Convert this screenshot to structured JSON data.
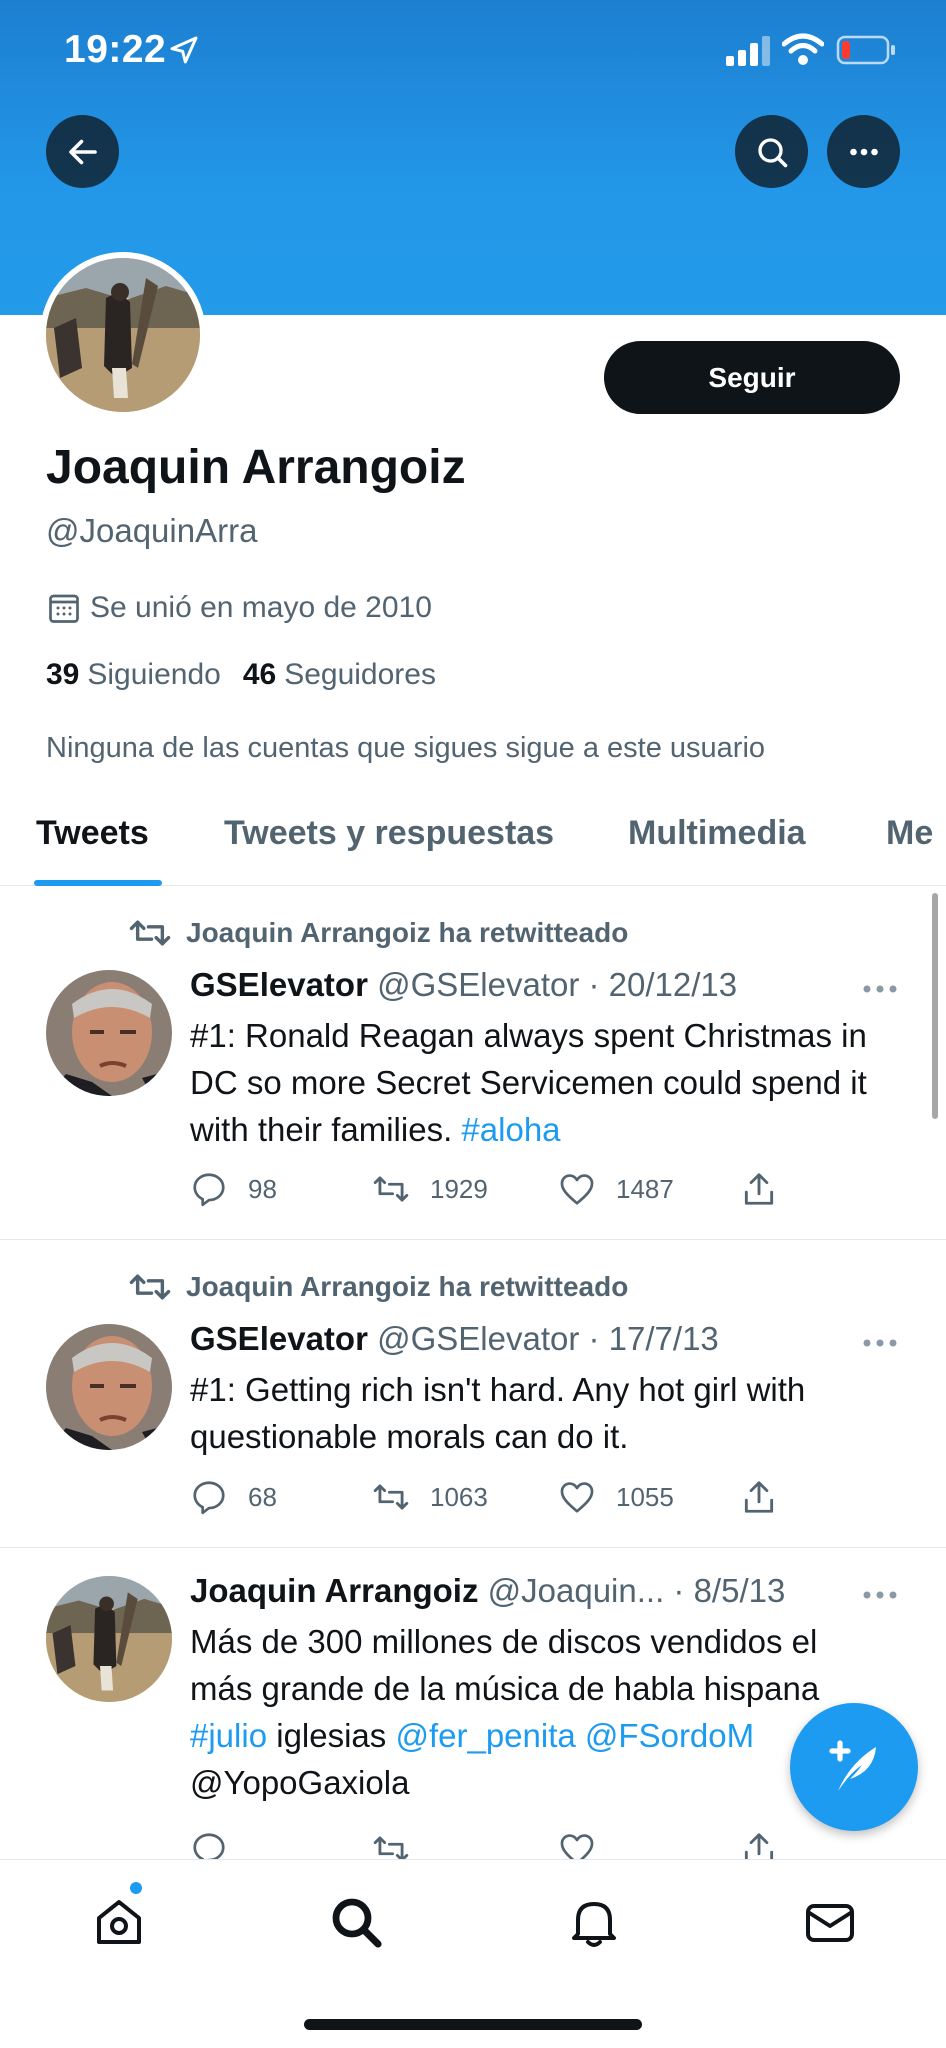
{
  "status_bar": {
    "time": "19:22"
  },
  "profile": {
    "follow_label": "Seguir",
    "name": "Joaquin Arrangoiz",
    "handle": "@JoaquinArra",
    "joined": "Se unió en mayo de 2010",
    "following_count": "39",
    "following_label": "Siguiendo",
    "followers_count": "46",
    "followers_label": "Seguidores",
    "followed_by_note": "Ninguna de las cuentas que sigues sigue a este usuario"
  },
  "tabs": [
    {
      "label": "Tweets",
      "active": true
    },
    {
      "label": "Tweets y respuestas",
      "active": false
    },
    {
      "label": "Multimedia",
      "active": false
    },
    {
      "label": "Me",
      "active": false
    }
  ],
  "tweets": [
    {
      "retweet_note": "Joaquin Arrangoiz ha retwitteado",
      "name": "GSElevator",
      "handle": "@GSElevator",
      "date": "· 20/12/13",
      "text_plain": "#1: Ronald Reagan always spent Christmas in DC so more Secret Servicemen could spend it with their families.",
      "hashtag": "#aloha",
      "replies": "98",
      "retweets": "1929",
      "likes": "1487"
    },
    {
      "retweet_note": "Joaquin Arrangoiz ha retwitteado",
      "name": "GSElevator",
      "handle": "@GSElevator",
      "date": "· 17/7/13",
      "text_plain": "#1: Getting rich isn't hard. Any hot girl with questionable morals can do it.",
      "replies": "68",
      "retweets": "1063",
      "likes": "1055"
    },
    {
      "name": "Joaquin Arrangoiz",
      "handle": "@Joaquin...",
      "date": "· 8/5/13",
      "text_line1": "Más de 300 millones de discos vendidos el",
      "text_line2": "más grande de la música de habla hispana",
      "hashtag": "#julio",
      "word": "iglesias",
      "mention1": "@fer_penita",
      "mention2": "@FSordoM",
      "mention3": "@YopoGaxiola"
    }
  ],
  "colors": {
    "accent": "#1d9bf0",
    "banner": "#2397e8",
    "text": "#0f1419",
    "muted": "#536471"
  }
}
